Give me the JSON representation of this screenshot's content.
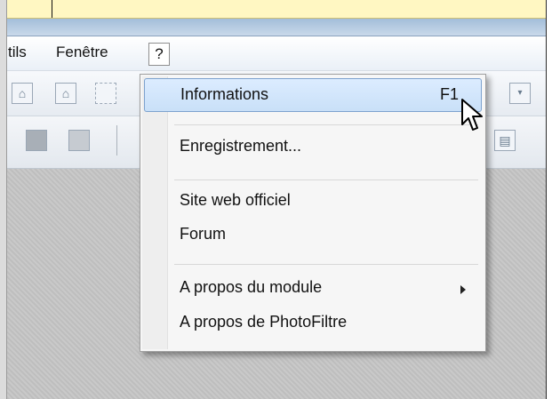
{
  "menubar": {
    "items": [
      {
        "label": "tils"
      },
      {
        "label": "Fenêtre"
      },
      {
        "label": "?"
      }
    ]
  },
  "dropdown": {
    "items": [
      {
        "label": "Informations",
        "shortcut": "F1",
        "highlighted": true
      },
      {
        "label": "Enregistrement..."
      },
      {
        "label": "Site web officiel"
      },
      {
        "label": "Forum"
      },
      {
        "label": "A propos du module",
        "has_submenu": true
      },
      {
        "label": "A propos de PhotoFiltre"
      }
    ]
  },
  "icons": {
    "toolbar_row1": [
      "frame-icon",
      "frame-icon",
      "selection-icon",
      "dropdown-arrow-icon"
    ],
    "toolbar_row2": [
      "grid-icon",
      "grid-icon",
      "filter-icon"
    ],
    "cursor": "mouse-pointer-icon"
  },
  "colors": {
    "menu_highlight": "#c9e0f8",
    "menu_highlight_border": "#7da2ce",
    "canvas": "#c6c6c6"
  }
}
